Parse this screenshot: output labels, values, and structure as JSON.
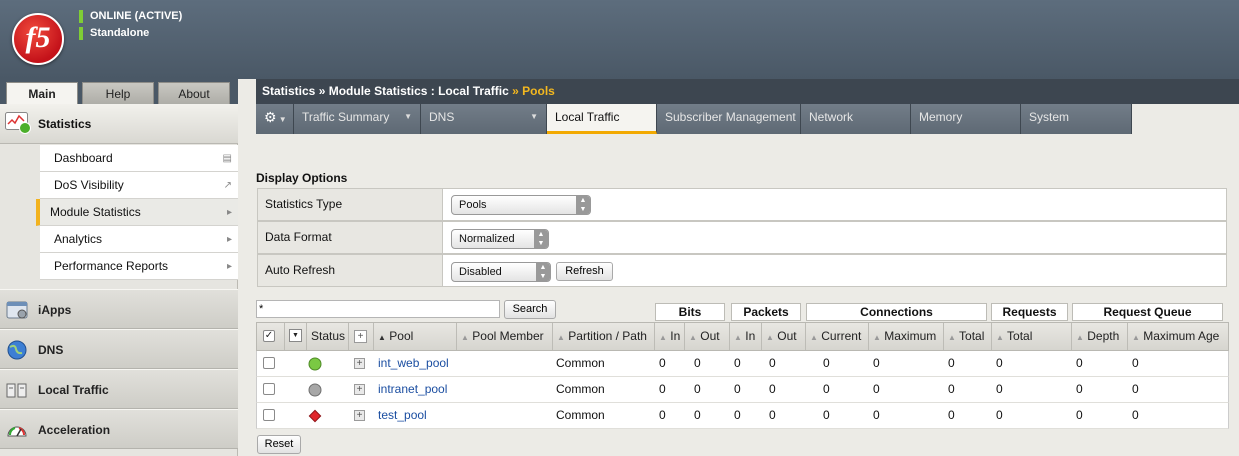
{
  "header": {
    "logo": "f5",
    "status": "ONLINE (ACTIVE)",
    "mode": "Standalone",
    "status_color": "#7fcd35"
  },
  "sidebar": {
    "tabs": [
      "Main",
      "Help",
      "About"
    ],
    "section_title": "Statistics",
    "items": [
      {
        "label": "Dashboard",
        "icon": "window-icon"
      },
      {
        "label": "DoS Visibility",
        "icon": "external-link-icon"
      },
      {
        "label": "Module Statistics",
        "icon": "chevron-right-icon",
        "selected": true
      },
      {
        "label": "Analytics",
        "icon": "chevron-right-icon"
      },
      {
        "label": "Performance Reports",
        "icon": "chevron-right-icon"
      }
    ],
    "groups": [
      {
        "label": "iApps",
        "icon": "iapps-icon"
      },
      {
        "label": "DNS",
        "icon": "globe-icon"
      },
      {
        "label": "Local Traffic",
        "icon": "servers-icon"
      },
      {
        "label": "Acceleration",
        "icon": "gauge-icon"
      }
    ]
  },
  "breadcrumb": {
    "p1": "Statistics",
    "sep": "»",
    "p2": "Module Statistics : Local Traffic",
    "p3": "Pools"
  },
  "tabs": [
    {
      "label": "Traffic Summary",
      "dropdown": true
    },
    {
      "label": "DNS",
      "dropdown": true
    },
    {
      "label": "Local Traffic",
      "active": true
    },
    {
      "label": "Subscriber Management"
    },
    {
      "label": "Network"
    },
    {
      "label": "Memory"
    },
    {
      "label": "System"
    }
  ],
  "display_options": {
    "title": "Display Options",
    "statistics_type": {
      "label": "Statistics Type",
      "value": "Pools"
    },
    "data_format": {
      "label": "Data Format",
      "value": "Normalized"
    },
    "auto_refresh": {
      "label": "Auto Refresh",
      "value": "Disabled",
      "refresh_button": "Refresh"
    }
  },
  "search": {
    "value": "*",
    "button": "Search"
  },
  "groups": [
    "Bits",
    "Packets",
    "Connections",
    "Requests",
    "Request Queue"
  ],
  "columns": [
    "Status",
    "Pool",
    "Pool Member",
    "Partition / Path",
    "In",
    "Out",
    "In",
    "Out",
    "Current",
    "Maximum",
    "Total",
    "Total",
    "Depth",
    "Maximum Age"
  ],
  "rows": [
    {
      "status": "green",
      "pool": "int_web_pool",
      "partition": "Common",
      "values": [
        "0",
        "0",
        "0",
        "0",
        "0",
        "0",
        "0",
        "0",
        "0",
        "0"
      ]
    },
    {
      "status": "gray",
      "pool": "intranet_pool",
      "partition": "Common",
      "values": [
        "0",
        "0",
        "0",
        "0",
        "0",
        "0",
        "0",
        "0",
        "0",
        "0"
      ]
    },
    {
      "status": "red",
      "pool": "test_pool",
      "partition": "Common",
      "values": [
        "0",
        "0",
        "0",
        "0",
        "0",
        "0",
        "0",
        "0",
        "0",
        "0"
      ]
    }
  ],
  "reset_button": "Reset",
  "colors": {
    "accent": "#f2a900",
    "link": "#1b4ea1",
    "header": "#4a5866"
  }
}
